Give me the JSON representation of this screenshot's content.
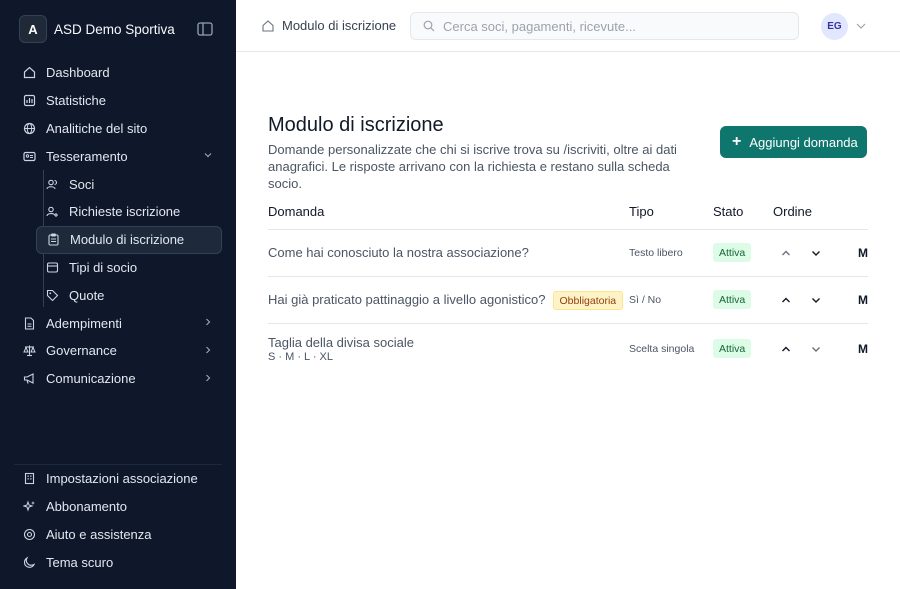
{
  "sidebar": {
    "brand_initial": "A",
    "brand_name": "ASD Demo Sportiva",
    "items": [
      {
        "label": "Dashboard"
      },
      {
        "label": "Statistiche"
      },
      {
        "label": "Analitiche del sito"
      },
      {
        "label": "Tesseramento"
      },
      {
        "label": "Soci"
      },
      {
        "label": "Richieste iscrizione"
      },
      {
        "label": "Modulo di iscrizione"
      },
      {
        "label": "Tipi di socio"
      },
      {
        "label": "Quote"
      },
      {
        "label": "Adempimenti"
      },
      {
        "label": "Governance"
      },
      {
        "label": "Comunicazione"
      }
    ],
    "bottom": [
      {
        "label": "Impostazioni associazione"
      },
      {
        "label": "Abbonamento"
      },
      {
        "label": "Aiuto e assistenza"
      },
      {
        "label": "Tema scuro"
      }
    ]
  },
  "header": {
    "breadcrumb": "Modulo di iscrizione",
    "search_placeholder": "Cerca soci, pagamenti, ricevute...",
    "avatar_initials": "EG"
  },
  "main": {
    "title": "Modulo di iscrizione",
    "description": "Domande personalizzate che chi si iscrive trova su /iscriviti, oltre ai dati anagrafici. Le risposte arrivano con la richiesta e restano sulla scheda socio.",
    "add_button": "Aggiungi domanda",
    "columns": {
      "question": "Domanda",
      "type": "Tipo",
      "status": "Stato",
      "order": "Ordine"
    },
    "rows": [
      {
        "question": "Come hai conosciuto la nostra associazione?",
        "type": "Testo libero",
        "status": "Attiva",
        "more": "M"
      },
      {
        "question": "Hai già praticato pattinaggio a livello agonistico?",
        "required": "Obbligatoria",
        "type": "Sì / No",
        "status": "Attiva",
        "more": "M"
      },
      {
        "question": "Taglia della divisa sociale",
        "options": "S · M · L · XL",
        "type": "Scelta singola",
        "status": "Attiva",
        "more": "M"
      }
    ]
  },
  "colors": {
    "sidebar_bg": "#0f172a",
    "accent": "#0f766e",
    "active_badge_bg": "#dcfce7",
    "required_badge_bg": "#fef3c7"
  }
}
